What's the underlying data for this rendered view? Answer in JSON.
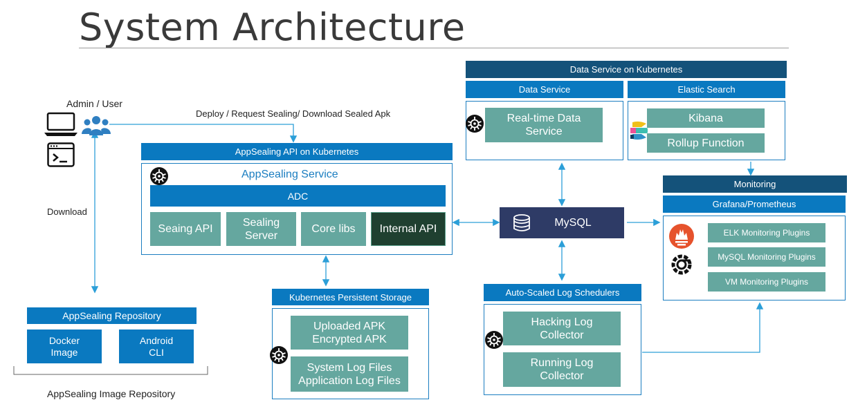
{
  "title": "System Architecture",
  "actor": {
    "label": "Admin / User",
    "icons": [
      "laptop-icon",
      "users-icon",
      "terminal-icon"
    ]
  },
  "edges": {
    "deploy_label": "Deploy / Request Sealing/ Download Sealed Apk",
    "download_label": "Download"
  },
  "appsealing_api": {
    "header": "AppSealing API on Kubernetes",
    "service_label": "AppSealing Service",
    "adc": "ADC",
    "modules": [
      "Seaing API",
      "Sealing Server",
      "Core libs",
      "Internal API"
    ],
    "icon": "kubernetes-icon"
  },
  "repository": {
    "header": "AppSealing Repository",
    "items": [
      "Docker Image",
      "Android CLI"
    ],
    "caption": "AppSealing Image Repository"
  },
  "storage": {
    "header": "Kubernetes Persistent Storage",
    "items": [
      "Uploaded APK Encrypted APK",
      "System Log Files Application Log Files"
    ],
    "items_lines": [
      [
        "Uploaded APK",
        "Encrypted APK"
      ],
      [
        "System Log Files",
        "Application Log Files"
      ]
    ],
    "icon": "kubernetes-icon"
  },
  "data_service": {
    "header": "Data Service  on Kubernetes",
    "sub_data": "Data Service",
    "sub_elastic": "Elastic Search",
    "realtime_lines": [
      "Real-time Data",
      "Service"
    ],
    "kibana": "Kibana",
    "rollup": "Rollup Function",
    "icons": [
      "kubernetes-icon",
      "elastic-icon"
    ]
  },
  "mysql": {
    "label": "MySQL",
    "icon": "database-icon"
  },
  "log_schedulers": {
    "header": "Auto-Scaled Log Schedulers",
    "items_lines": [
      [
        "Hacking Log",
        "Collector"
      ],
      [
        "Running Log",
        "Collector"
      ]
    ],
    "icon": "kubernetes-icon"
  },
  "monitoring": {
    "header": "Monitoring",
    "sub": "Grafana/Prometheus",
    "plugins": [
      "ELK Monitoring Plugins",
      "MySQL Monitoring Plugins",
      "VM Monitoring Plugins"
    ],
    "icons": [
      "prometheus-icon",
      "grafana-icon"
    ]
  },
  "colors": {
    "header_dark": "#14527a",
    "header_blue": "#0a79c0",
    "teal": "#65a79f",
    "internal_api": "#1f4030",
    "mysql": "#2e3b66",
    "arrow": "#2c9fd8"
  }
}
